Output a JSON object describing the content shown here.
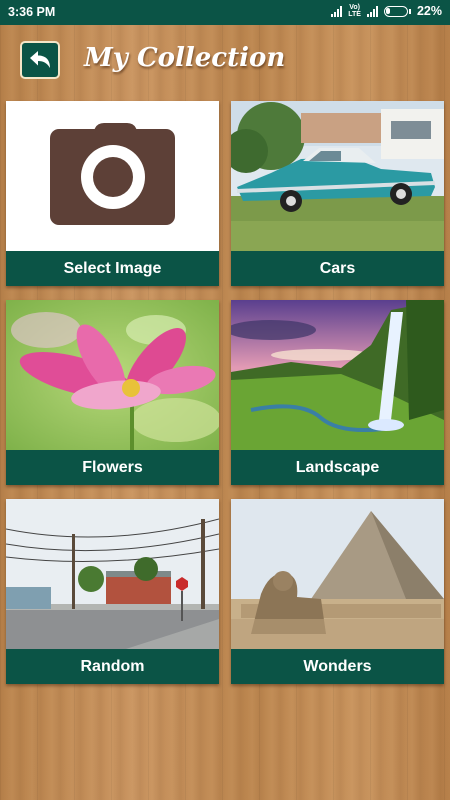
{
  "status_bar": {
    "time": "3:36 PM",
    "network_label": "Vo) LTE",
    "battery_percent": "22%",
    "battery_level": 0.22
  },
  "header": {
    "title": "My Collection",
    "back_icon": "back-arrow-icon"
  },
  "colors": {
    "primary": "#0b5446",
    "wood": "#c08a54",
    "camera": "#5d4037"
  },
  "categories": [
    {
      "label": "Select Image",
      "icon": "camera-icon"
    },
    {
      "label": "Cars"
    },
    {
      "label": "Flowers"
    },
    {
      "label": "Landscape"
    },
    {
      "label": "Random"
    },
    {
      "label": "Wonders"
    }
  ]
}
